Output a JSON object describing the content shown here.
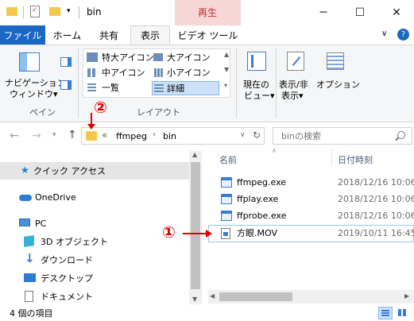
{
  "window": {
    "title": "bin",
    "context_tab_label": "再生",
    "minimize_glyph": "─",
    "maximize_glyph": "☐",
    "close_glyph": "✕"
  },
  "tabs": [
    "ファイル",
    "ホーム",
    "共有",
    "表示",
    "ビデオ ツール"
  ],
  "ribbon": {
    "pane_group": {
      "nav_pane_label": [
        "ナビゲーション",
        "ウィンドウ▾"
      ],
      "group_label": "ペイン"
    },
    "layout_group": {
      "items": [
        "特大アイコン",
        "大アイコン",
        "中アイコン",
        "小アイコン",
        "一覧",
        "詳細"
      ],
      "group_label": "レイアウト"
    },
    "current_view": [
      "現在の",
      "ビュー▾"
    ],
    "show_hide": [
      "表示/非",
      "表示▾"
    ],
    "options": "オプション"
  },
  "address": {
    "prefix": "«",
    "crumbs": [
      "ffmpeg",
      "bin"
    ],
    "search_placeholder": "binの検索"
  },
  "annotations": {
    "circle_1": "①",
    "circle_2": "②"
  },
  "nav_pane": {
    "items": [
      "クイック アクセス",
      "OneDrive",
      "PC",
      "3D オブジェクト",
      "ダウンロード",
      "デスクトップ",
      "ドキュメント"
    ]
  },
  "file_list": {
    "columns": {
      "name": "名前",
      "date": "日付時刻"
    },
    "rows": [
      {
        "name": "ffmpeg.exe",
        "date": "2018/12/16 10:06"
      },
      {
        "name": "ffplay.exe",
        "date": "2018/12/16 10:06"
      },
      {
        "name": "ffprobe.exe",
        "date": "2018/12/16 10:06"
      },
      {
        "name": "方眼.MOV",
        "date": "2019/10/11 16:45"
      }
    ]
  },
  "status": {
    "item_count": "4 個の項目"
  },
  "colors": {
    "accent": "#1a68c4",
    "annotation_red": "#e00000",
    "context_tab_bg": "#f7d7d6"
  }
}
